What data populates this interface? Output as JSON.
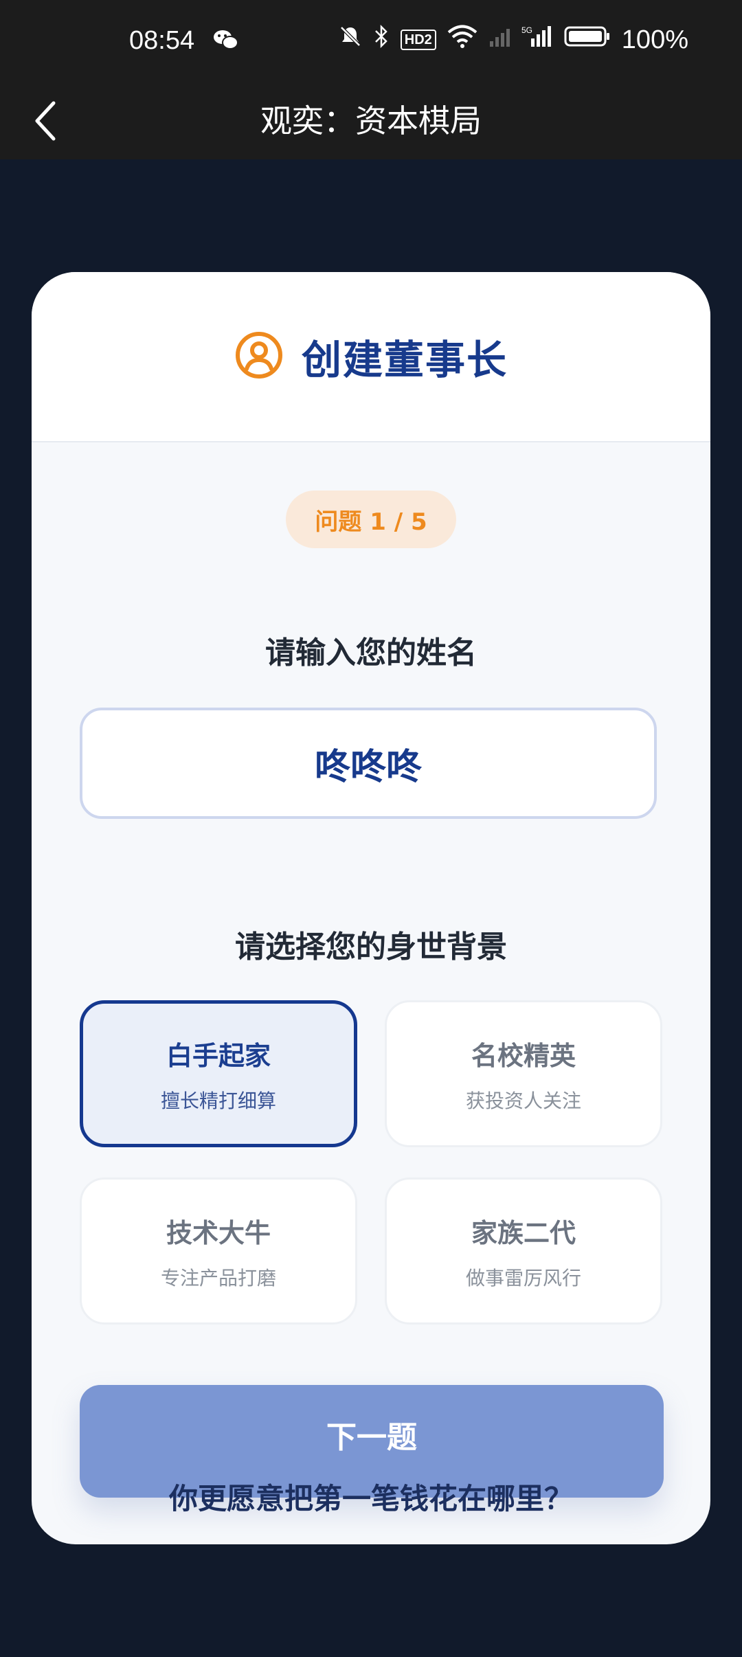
{
  "status_bar": {
    "time": "08:54",
    "hd_label": "HD2",
    "network": "5G",
    "battery": "100%",
    "icons": [
      "wechat-icon",
      "mute-icon",
      "bluetooth-icon",
      "wifi-icon",
      "signal-icon",
      "battery-icon"
    ]
  },
  "titlebar": {
    "title": "观奕：资本棋局",
    "back_icon": "chevron-left-icon"
  },
  "card": {
    "heading": "创建董事长",
    "heading_icon": "user-circle-icon",
    "progress_badge": "问题 1 / 5",
    "name_label": "请输入您的姓名",
    "name_value": "咚咚咚",
    "background_label": "请选择您的身世背景",
    "options": [
      {
        "title": "白手起家",
        "subtitle": "擅长精打细算",
        "selected": true
      },
      {
        "title": "名校精英",
        "subtitle": "获投资人关注",
        "selected": false
      },
      {
        "title": "技术大牛",
        "subtitle": "专注产品打磨",
        "selected": false
      },
      {
        "title": "家族二代",
        "subtitle": "做事雷厉风行",
        "selected": false
      }
    ],
    "next_button": "下一题",
    "next_question_preview": "你更愿意把第一笔钱花在哪里？"
  },
  "colors": {
    "accent_orange": "#ee8a1e",
    "brand_blue": "#173a8c",
    "button_blue": "#7b96d3",
    "page_bg": "#111a2b"
  }
}
